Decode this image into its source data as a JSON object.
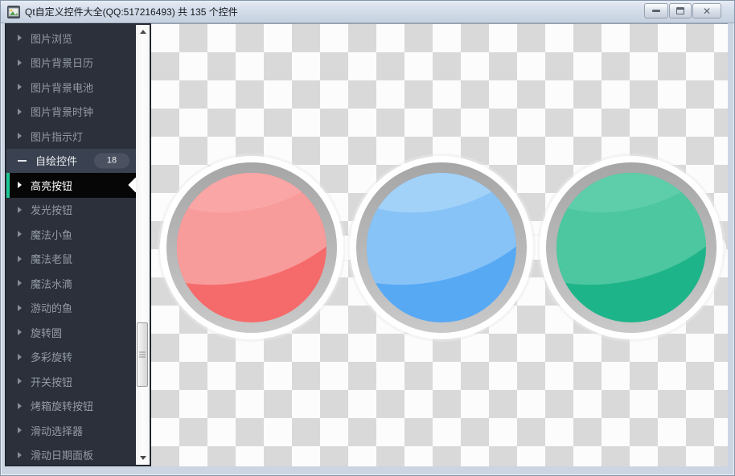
{
  "window": {
    "title": "Qt自定义控件大全(QQ:517216493) 共 135 个控件"
  },
  "titlebar": {
    "buttons": [
      {
        "name": "minimize-button",
        "icon": "minimize-icon"
      },
      {
        "name": "maximize-button",
        "icon": "maximize-icon"
      },
      {
        "name": "close-button",
        "icon": "close-icon"
      }
    ]
  },
  "sidebar": {
    "items": [
      {
        "label": "图片浏览",
        "state": "collapsed"
      },
      {
        "label": "图片背景日历",
        "state": "collapsed"
      },
      {
        "label": "图片背景电池",
        "state": "collapsed"
      },
      {
        "label": "图片背景时钟",
        "state": "collapsed"
      },
      {
        "label": "图片指示灯",
        "state": "collapsed"
      },
      {
        "label": "自绘控件",
        "state": "expanded",
        "badge": "18"
      },
      {
        "label": "高亮按钮",
        "state": "selected"
      },
      {
        "label": "发光按钮",
        "state": "collapsed"
      },
      {
        "label": "魔法小鱼",
        "state": "collapsed"
      },
      {
        "label": "魔法老鼠",
        "state": "collapsed"
      },
      {
        "label": "魔法水滴",
        "state": "collapsed"
      },
      {
        "label": "游动的鱼",
        "state": "collapsed"
      },
      {
        "label": "旋转圆",
        "state": "collapsed"
      },
      {
        "label": "多彩旋转",
        "state": "collapsed"
      },
      {
        "label": "开关按钮",
        "state": "collapsed"
      },
      {
        "label": "烤箱旋转按钮",
        "state": "collapsed"
      },
      {
        "label": "滑动选择器",
        "state": "collapsed"
      },
      {
        "label": "滑动日期面板",
        "state": "collapsed"
      }
    ],
    "colors": {
      "background": "#2b303a",
      "item_text": "#959ba5",
      "selected_bg": "#060606",
      "selected_text": "#ffffff",
      "accent": "#1ec895",
      "expanded_bg": "#3a4150",
      "badge_bg": "#4b5160"
    }
  },
  "content": {
    "checker": {
      "light": "#fcfcfc",
      "dark": "#d9d9d9"
    },
    "ring": {
      "top": "#a6a6a6",
      "bottom": "#c9c9c9",
      "halo": "#ffffff"
    },
    "buttons": [
      {
        "name": "red-glass-button",
        "base": "#f56b6b",
        "light": "#f89b9b",
        "shine": "#fba6a6"
      },
      {
        "name": "blue-glass-button",
        "base": "#57a9f4",
        "light": "#88c3f7",
        "shine": "#a3d2f9"
      },
      {
        "name": "green-glass-button",
        "base": "#1eb489",
        "light": "#4cc79f",
        "shine": "#5ecdaa"
      }
    ]
  }
}
